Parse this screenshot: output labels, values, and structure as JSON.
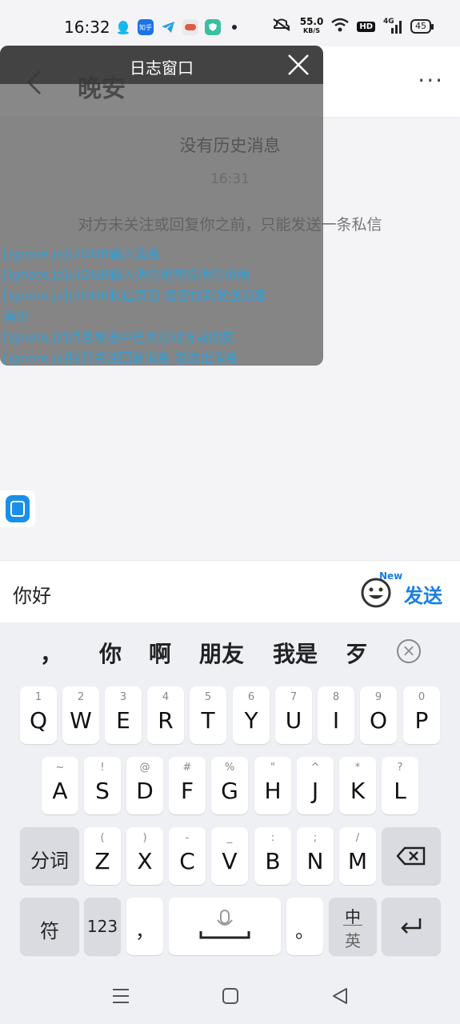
{
  "status": {
    "time": "16:32",
    "speed": "55.0",
    "speed_unit": "KB/S",
    "hd": "HD",
    "battery": "45",
    "network": "4G",
    "app_label": "知乎"
  },
  "header": {
    "title": "晚安"
  },
  "chat": {
    "no_history": "没有历史消息",
    "timestamp": "16:31",
    "notice": "对方未关注或回复你之前，只能发送一条私信"
  },
  "log_window": {
    "title": "日志窗口",
    "lines": [
      "[ignore.js]UIDUB输入消息",
      "[ignore.js]UIDUB输入消息用完成消息页面",
      "[ignore.js]UIDUB私信页面 是否找到发送消息",
      "消息",
      "[ignore.js]消息发送中已关注对方或回复",
      "[ignore.js]找开关注回复消息 发送出消息"
    ]
  },
  "input": {
    "value": "你好",
    "emoji_badge": "New",
    "send_label": "发送"
  },
  "keyboard": {
    "candidates": [
      "，",
      "你",
      "啊",
      "朋友",
      "我是",
      "歹"
    ],
    "row1": [
      {
        "hint": "1",
        "key": "Q"
      },
      {
        "hint": "2",
        "key": "W"
      },
      {
        "hint": "3",
        "key": "E"
      },
      {
        "hint": "4",
        "key": "R"
      },
      {
        "hint": "5",
        "key": "T"
      },
      {
        "hint": "6",
        "key": "Y"
      },
      {
        "hint": "7",
        "key": "U"
      },
      {
        "hint": "8",
        "key": "I"
      },
      {
        "hint": "9",
        "key": "O"
      },
      {
        "hint": "0",
        "key": "P"
      }
    ],
    "row2": [
      {
        "hint": "~",
        "key": "A"
      },
      {
        "hint": "!",
        "key": "S"
      },
      {
        "hint": "@",
        "key": "D"
      },
      {
        "hint": "#",
        "key": "F"
      },
      {
        "hint": "%",
        "key": "G"
      },
      {
        "hint": "\"",
        "key": "H"
      },
      {
        "hint": "^",
        "key": "J"
      },
      {
        "hint": "*",
        "key": "K"
      },
      {
        "hint": "?",
        "key": "L"
      }
    ],
    "row3": [
      {
        "hint": "(",
        "key": "Z"
      },
      {
        "hint": ")",
        "key": "X"
      },
      {
        "hint": "-",
        "key": "C"
      },
      {
        "hint": "_",
        "key": "V"
      },
      {
        "hint": ":",
        "key": "B"
      },
      {
        "hint": ";",
        "key": "N"
      },
      {
        "hint": "/",
        "key": "M"
      }
    ],
    "fenci": "分词",
    "symbols": "符",
    "numbers": "123",
    "comma": "，",
    "period": "。",
    "lang_top": "中",
    "lang_bottom": "英"
  }
}
